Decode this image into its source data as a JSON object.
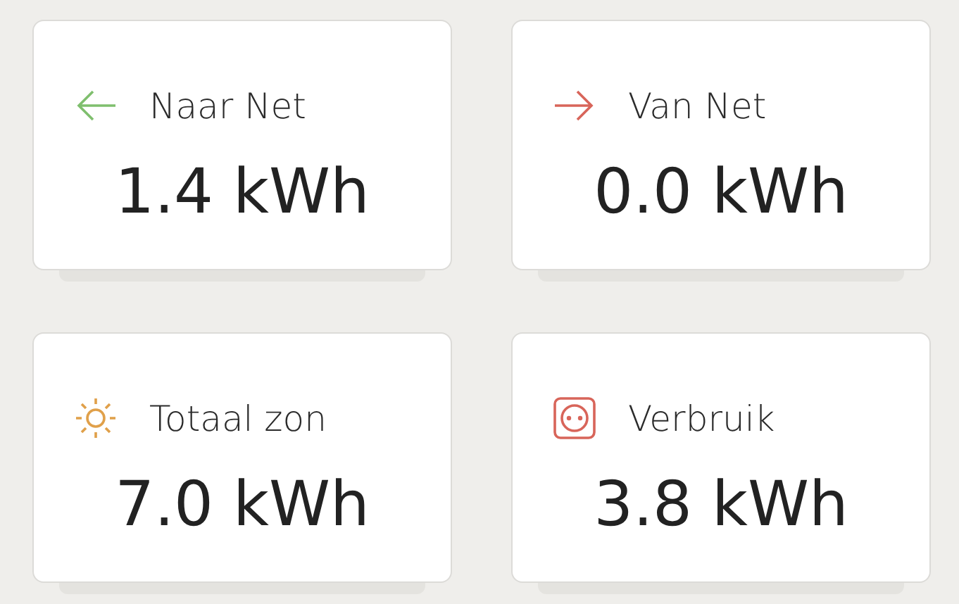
{
  "tiles": [
    {
      "kind": "export",
      "label": "Naar Net",
      "value": "1.4 kWh"
    },
    {
      "kind": "import",
      "label": "Van Net",
      "value": "0.0 kWh"
    },
    {
      "kind": "solar",
      "label": "Totaal zon",
      "value": "7.0 kWh"
    },
    {
      "kind": "consumption",
      "label": "Verbruik",
      "value": "3.8 kWh"
    }
  ]
}
